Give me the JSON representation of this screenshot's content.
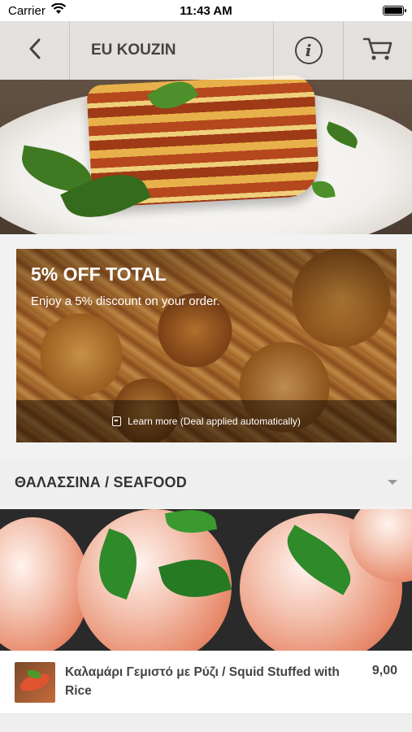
{
  "status_bar": {
    "carrier": "Carrier",
    "time": "11:43 AM",
    "icons": [
      "wifi-icon",
      "battery-icon"
    ]
  },
  "navbar": {
    "title": "EU KOUZIN",
    "icons": [
      "back-chevron-icon",
      "info-icon",
      "cart-icon"
    ]
  },
  "deal": {
    "title": "5% OFF TOTAL",
    "subtitle": "Enjoy a 5% discount on your order.",
    "footer": "Learn more (Deal applied automatically)"
  },
  "category": {
    "title": "ΘΑΛΑΣΣΙΝΑ / SEAFOOD"
  },
  "items": [
    {
      "name": "Καλαμάρι Γεμιστό με Ρύζι / Squid Stuffed with Rice",
      "price": "9,00"
    }
  ],
  "colors": {
    "text_dark": "#444444",
    "nav_bg": "#ffffff",
    "category_bg": "#efefef"
  }
}
